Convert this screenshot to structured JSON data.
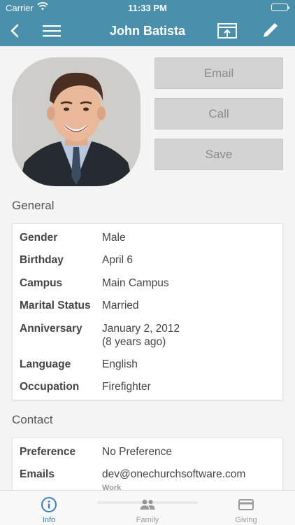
{
  "status_bar": {
    "carrier": "Carrier",
    "time": "11:33 PM"
  },
  "nav": {
    "title": "John Batista"
  },
  "actions": {
    "email": "Email",
    "call": "Call",
    "save": "Save"
  },
  "general": {
    "title": "General",
    "rows": [
      {
        "label": "Gender",
        "value": "Male"
      },
      {
        "label": "Birthday",
        "value": "April 6"
      },
      {
        "label": "Campus",
        "value": "Main Campus"
      },
      {
        "label": "Marital Status",
        "value": "Married"
      },
      {
        "label": "Anniversary",
        "value": "January 2, 2012",
        "value2": "(8 years ago)"
      },
      {
        "label": "Language",
        "value": "English"
      },
      {
        "label": "Occupation",
        "value": "Firefighter"
      }
    ]
  },
  "contact": {
    "title": "Contact",
    "rows": [
      {
        "label": "Preference",
        "value": "No Preference"
      },
      {
        "label": "Emails",
        "value": "dev@onechurchsoftware.com",
        "sub": "Work"
      }
    ]
  },
  "tabs": [
    {
      "label": "Info",
      "icon": "info-icon",
      "active": true
    },
    {
      "label": "Family",
      "icon": "family-icon",
      "active": false
    },
    {
      "label": "Giving",
      "icon": "credit-card-icon",
      "active": false
    }
  ],
  "colors": {
    "nav_bg": "#4a90ad",
    "tab_active": "#3a7fc4",
    "tab_inactive": "#9a9a9a"
  }
}
